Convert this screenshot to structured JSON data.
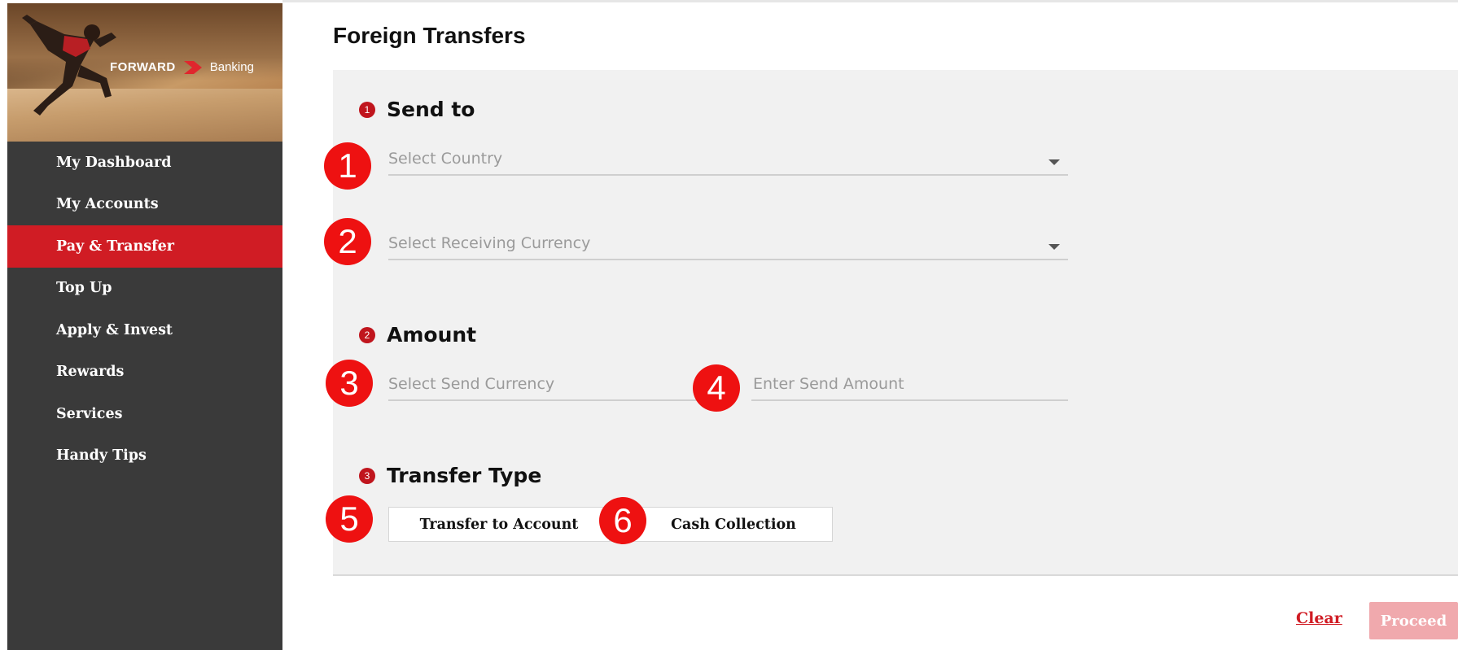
{
  "brand": {
    "logo_primary": "FORWARD",
    "logo_secondary": "Banking",
    "accent_color": "#d01c24"
  },
  "sidebar": {
    "items": [
      {
        "label": "My Dashboard",
        "active": false
      },
      {
        "label": "My Accounts",
        "active": false
      },
      {
        "label": "Pay & Transfer",
        "active": true
      },
      {
        "label": "Top Up",
        "active": false
      },
      {
        "label": "Apply & Invest",
        "active": false
      },
      {
        "label": "Rewards",
        "active": false
      },
      {
        "label": "Services",
        "active": false
      },
      {
        "label": "Handy Tips",
        "active": false
      }
    ]
  },
  "page": {
    "title": "Foreign Transfers"
  },
  "sections": {
    "send_to": {
      "step": "1",
      "label": "Send to"
    },
    "amount": {
      "step": "2",
      "label": "Amount"
    },
    "transfer_type": {
      "step": "3",
      "label": "Transfer Type"
    }
  },
  "fields": {
    "country": {
      "placeholder": "Select Country",
      "value": ""
    },
    "receiving_currency": {
      "placeholder": "Select Receiving Currency",
      "value": ""
    },
    "send_currency": {
      "placeholder": "Select Send Currency",
      "value": ""
    },
    "send_amount": {
      "placeholder": "Enter Send Amount",
      "value": ""
    }
  },
  "buttons": {
    "transfer_to_account": "Transfer to Account",
    "cash_collection": "Cash Collection",
    "clear": "Clear",
    "proceed": "Proceed"
  },
  "markers": [
    "1",
    "2",
    "3",
    "4",
    "5",
    "6"
  ],
  "icons": {
    "dropdown": "chevron-down-icon",
    "logo": "forward-chevron-icon",
    "banner": "runner-image"
  },
  "colors": {
    "sidebar_bg": "#3a3a3a",
    "active_nav": "#d01c24",
    "step_dot": "#c0151d",
    "marker": "#ee1111",
    "proceed_disabled": "#f0a9ad"
  }
}
